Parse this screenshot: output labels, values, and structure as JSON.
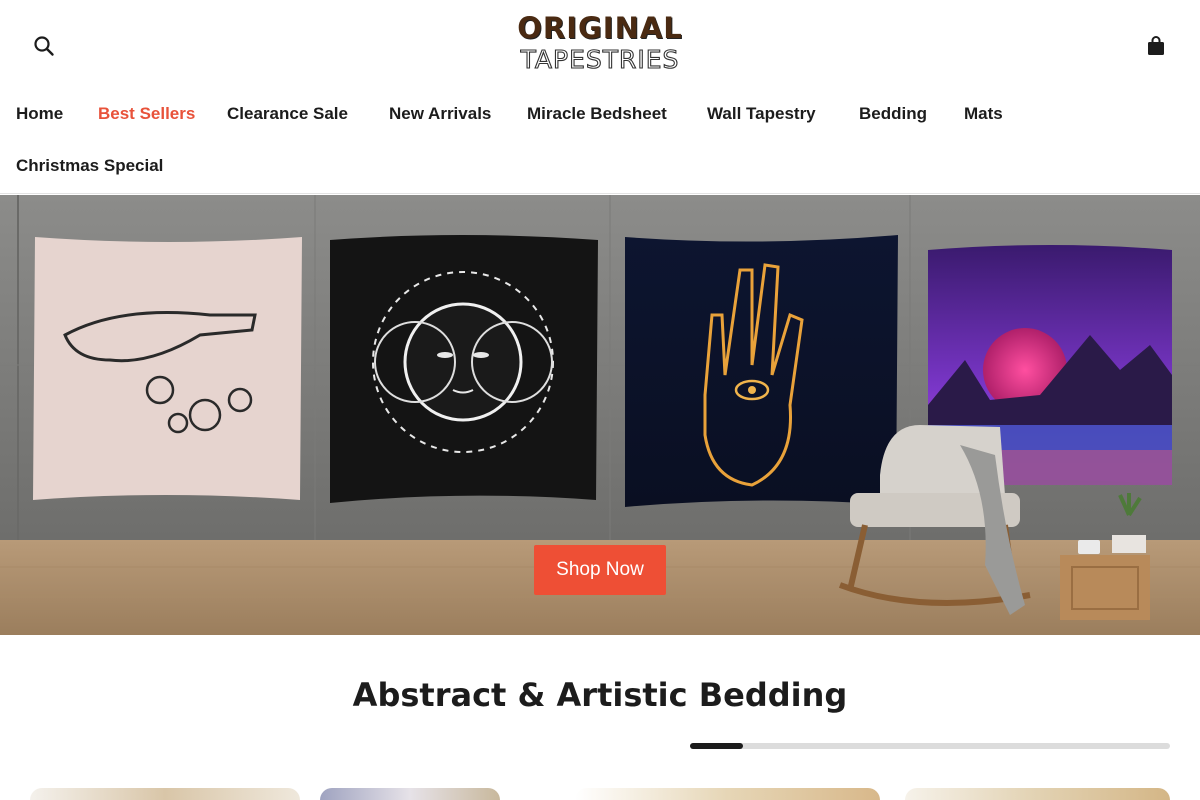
{
  "header": {
    "logo": {
      "line1": "ORIGINAL",
      "line2": "TAPESTRIES"
    },
    "search_icon": "search-icon",
    "cart_icon": "shopping-bag-icon"
  },
  "nav": {
    "items": [
      {
        "label": "Home",
        "active": false
      },
      {
        "label": "Best Sellers",
        "active": true
      },
      {
        "label": "Clearance Sale",
        "active": false
      },
      {
        "label": "New Arrivals",
        "active": false
      },
      {
        "label": "Miracle Bedsheet",
        "active": false
      },
      {
        "label": "Wall Tapestry",
        "active": false
      },
      {
        "label": "Bedding",
        "active": false
      },
      {
        "label": "Mats",
        "active": false
      },
      {
        "label": "Christmas Special",
        "active": false
      }
    ],
    "active_color": "#e8523a"
  },
  "hero": {
    "cta_label": "Shop Now",
    "cta_color": "#ee4f35"
  },
  "section": {
    "title": "Abstract & Artistic Bedding",
    "carousel_progress": 0.11
  }
}
